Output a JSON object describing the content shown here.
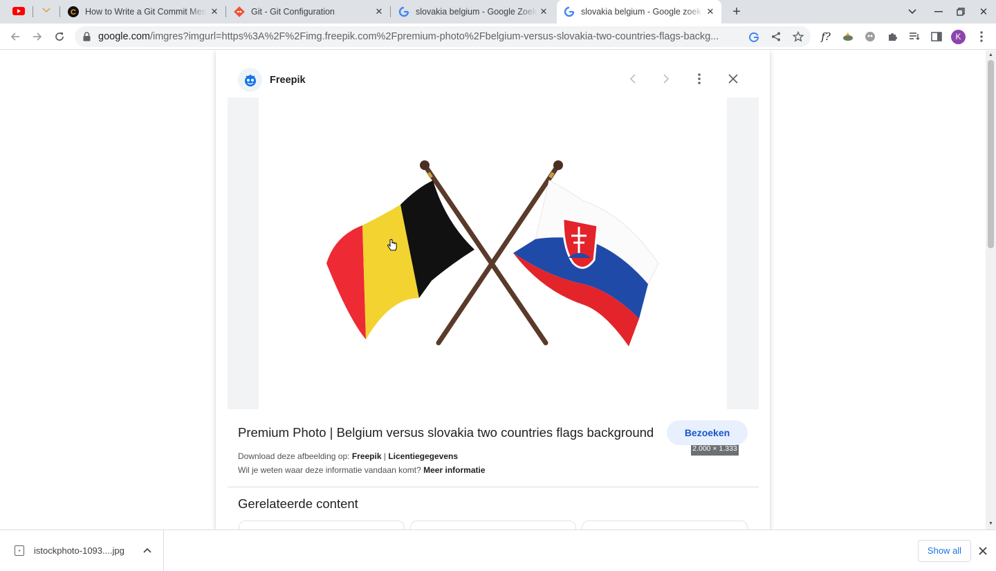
{
  "browser": {
    "tabs": [
      {
        "title": "",
        "favicon": "youtube-icon"
      },
      {
        "title": "",
        "favicon": "bird-icon"
      },
      {
        "title": "How to Write a Git Commit Mes",
        "favicon": "cbea-icon"
      },
      {
        "title": "Git - Git Configuration",
        "favicon": "git-icon"
      },
      {
        "title": "slovakia belgium - Google Zoek",
        "favicon": "google-icon"
      },
      {
        "title": "slovakia belgium - Google zoek",
        "favicon": "google-icon",
        "active": true
      }
    ],
    "address_bar": {
      "host": "google.com",
      "path": "/imgres?imgurl=https%3A%2F%2Fimg.freepik.com%2Fpremium-photo%2Fbelgium-versus-slovakia-two-countries-flags-backg..."
    },
    "profile_initial": "K",
    "extension_label": "f?"
  },
  "viewer": {
    "source_name": "Freepik",
    "image_dimensions": "2.000 × 1.333",
    "title": "Premium Photo | Belgium versus slovakia two countries flags background",
    "visit_label": "Bezoeken",
    "download_prefix": "Download deze afbeelding op:",
    "download_source": "Freepik",
    "separator": "|",
    "license_link": "Licentiegegevens",
    "info_question": "Wil je weten waar deze informatie vandaan komt?",
    "more_info": "Meer informatie",
    "related_heading": "Gerelateerde content",
    "colors": {
      "accent_bg": "#e8f0fe",
      "accent_text": "#1a55c9"
    }
  },
  "downloads": {
    "file_name": "istockphoto-1093....jpg",
    "show_all": "Show all"
  }
}
